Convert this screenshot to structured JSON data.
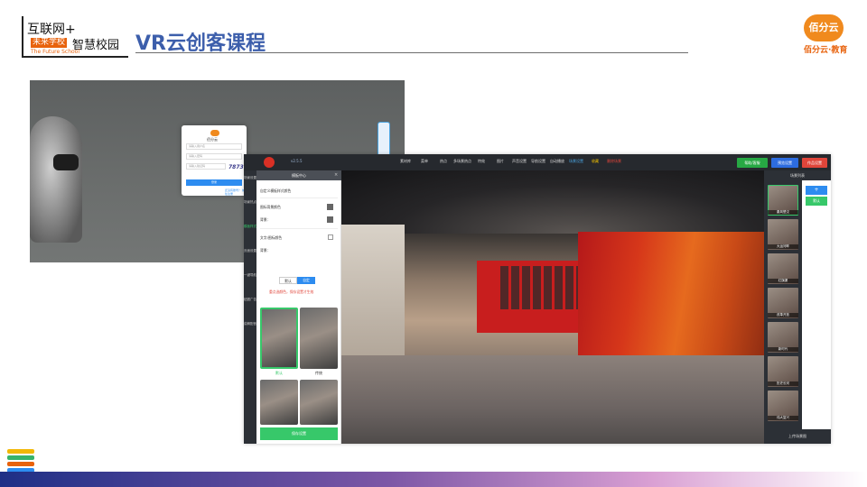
{
  "header": {
    "logo_line1": "互联网+",
    "logo_badge": "未来学校",
    "logo_line2": "智慧校园",
    "logo_line3": "The Future School",
    "title": "VR云创客课程",
    "brand_name": "佰分云",
    "brand_text": "佰分云·教育"
  },
  "login_shot": {
    "brand": "佰分云",
    "username_placeholder": "请输入用户名",
    "password_placeholder": "请输入密码",
    "captcha_placeholder": "请输入验证码",
    "captcha": "7873",
    "login_button": "登录",
    "link": "还没有账号？ 前往注册"
  },
  "editor": {
    "version": "v2.5.5",
    "toolbar": [
      "素材库",
      "菜单",
      "热点",
      "多场景热点",
      "特效",
      "图片",
      "声音设置",
      "导航设置",
      "自动播放",
      "场景设置",
      "收藏",
      "删除场景"
    ],
    "actions": {
      "help": "帮助/客服",
      "preview": "预览设置",
      "publish": "作品设置"
    },
    "leftnav": [
      "场景设置",
      "场景热点",
      "模板样式",
      "页面设置",
      "一键导航",
      "贴图广告",
      "讲解配音"
    ],
    "panel": {
      "title": "模板中心",
      "section1": "自定义模板样式颜色",
      "bg_color_label": "图标背景颜色",
      "bg_color_value": "背景：",
      "text_color_label": "文字/图标颜色",
      "text_color_value": "背景：",
      "seg_default": "默认",
      "seg_custom": "自定",
      "hint": "重点选颜色，保存设置才生效",
      "thumb1": "默认",
      "thumb2": "传统",
      "save": "保存设置"
    },
    "scene_list": {
      "title": "场景列表",
      "items": [
        "秦风楚汉",
        "大运河畔",
        "红旗渠",
        "改革开放",
        "新时代",
        "历史长河",
        "伟大复兴"
      ],
      "plus": "+",
      "default": "默认",
      "upload": "上传场景图"
    }
  },
  "colors": {
    "title_blue": "#3c5eab",
    "accent_green": "#37c86a",
    "accent_blue": "#2d8cf0",
    "alert_red": "#e0453a",
    "brand_orange": "#f08a1e"
  }
}
